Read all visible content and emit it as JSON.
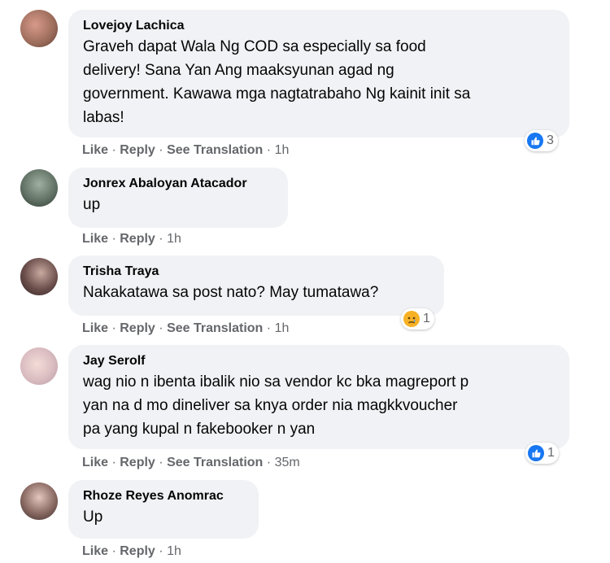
{
  "comments": [
    {
      "author": "Lovejoy Lachica",
      "lines": [
        "Graveh dapat Wala Ng COD sa especially sa food",
        "delivery! Sana Yan Ang maaksyunan agad ng",
        "government. Kawawa mga nagtatrabaho Ng kainit init sa",
        "labas!"
      ],
      "actions": [
        "Like",
        "Reply",
        "See Translation"
      ],
      "time": "1h",
      "reaction": {
        "icon": "like-icon",
        "count": "3"
      },
      "avatar_color": "#9a6b5a"
    },
    {
      "author": "Jonrex Abaloyan Atacador",
      "lines": [
        "up"
      ],
      "actions": [
        "Like",
        "Reply"
      ],
      "time": "1h",
      "avatar_color": "#6a7a6e"
    },
    {
      "author": "Trisha Traya",
      "lines": [
        "Nakakatawa sa post nato? May tumatawa?"
      ],
      "actions": [
        "Like",
        "Reply",
        "See Translation"
      ],
      "time": "1h",
      "reaction": {
        "icon": "sad-icon",
        "count": "1"
      },
      "avatar_color": "#4a3b3c"
    },
    {
      "author": "Jay Serolf",
      "lines": [
        "wag nio n ibenta ibalik nio sa vendor kc bka magreport p",
        "yan na d mo dineliver sa knya order nia magkkvoucher",
        "pa yang kupal n fakebooker n yan"
      ],
      "actions": [
        "Like",
        "Reply",
        "See Translation"
      ],
      "time": "35m",
      "reaction": {
        "icon": "like-icon",
        "count": "1"
      },
      "avatar_color": "#d8c4c8"
    },
    {
      "author": "Rhoze Reyes Anomrac",
      "lines": [
        "Up"
      ],
      "actions": [
        "Like",
        "Reply"
      ],
      "time": "1h",
      "avatar_color": "#7a5f5a"
    }
  ],
  "separator": "·",
  "colors": {
    "bubble": "#f0f2f5",
    "action_text": "#65676b",
    "like_blue": "#1877f2",
    "sad_yellow": "#f7b125"
  }
}
